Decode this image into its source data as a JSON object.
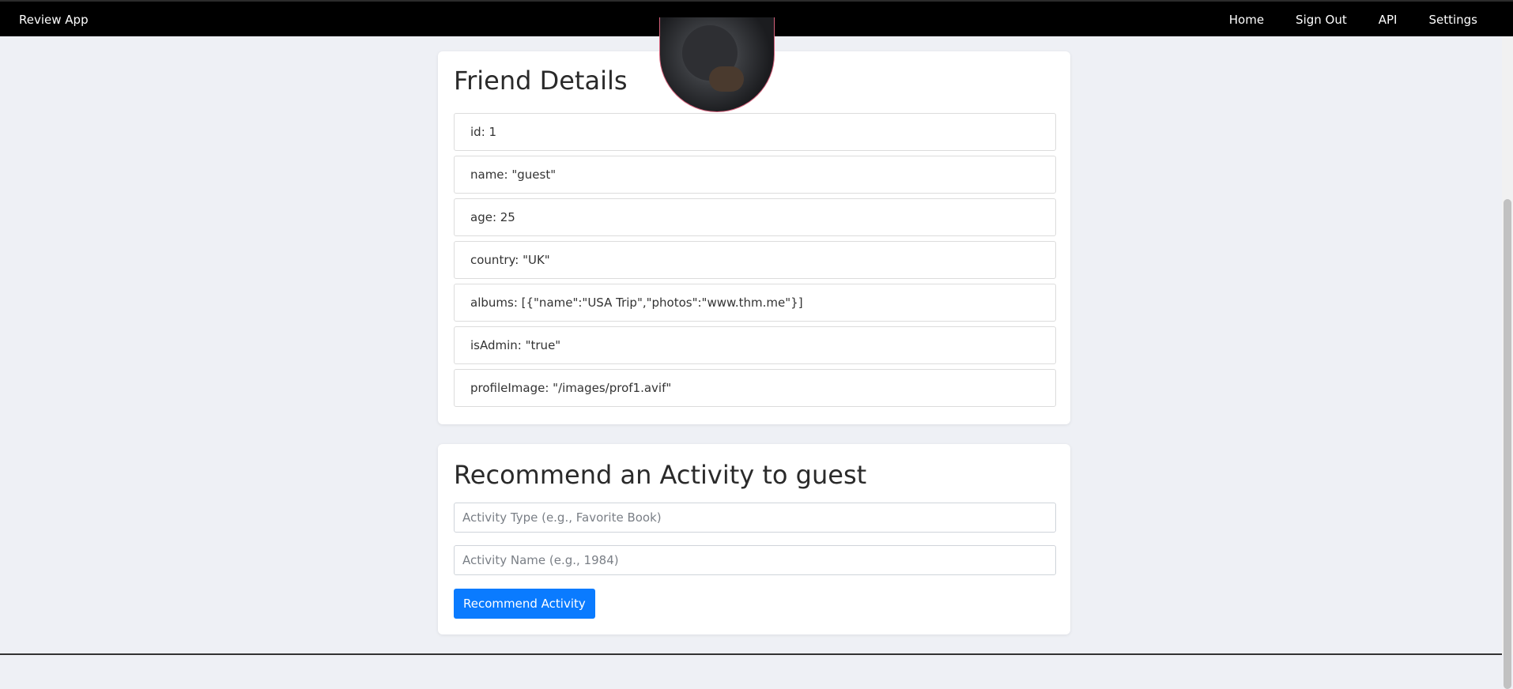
{
  "navbar": {
    "brand": "Review App",
    "links": [
      "Home",
      "Sign Out",
      "API",
      "Settings"
    ]
  },
  "details": {
    "title": "Friend Details",
    "items": [
      "id: 1",
      "name: \"guest\"",
      "age: 25",
      "country: \"UK\"",
      "albums: [{\"name\":\"USA Trip\",\"photos\":\"www.thm.me\"}]",
      "isAdmin: \"true\"",
      "profileImage: \"/images/prof1.avif\""
    ]
  },
  "recommend": {
    "title": "Recommend an Activity to guest",
    "activity_type_placeholder": "Activity Type (e.g., Favorite Book)",
    "activity_name_placeholder": "Activity Name (e.g., 1984)",
    "activity_type_value": "",
    "activity_name_value": "",
    "button_label": "Recommend Activity"
  },
  "colors": {
    "navbar": "#000000",
    "background": "#eef0f5",
    "button": "#0a7bff",
    "avatar_border": "#d4607a"
  },
  "icons": {
    "avatar": "profile-photo"
  }
}
